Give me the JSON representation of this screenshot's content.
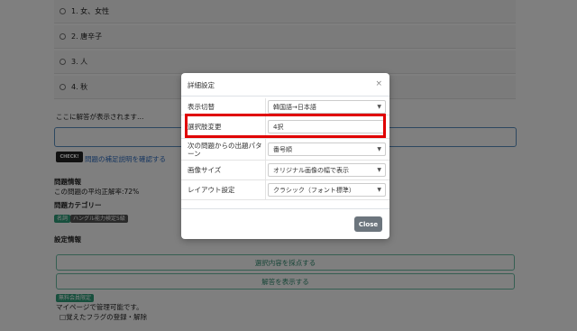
{
  "options": [
    {
      "label": "1. 女、女性"
    },
    {
      "label": "2. 唐辛子"
    },
    {
      "label": "3. 人"
    },
    {
      "label": "4. 秋"
    }
  ],
  "answer_placeholder": "ここに解答が表示されます…",
  "check_badge": "CHECK!",
  "supplement_link": "問題の補足説明を確認する",
  "problem_info": {
    "heading": "問題情報",
    "accuracy": "この問題の平均正解率:72%"
  },
  "category": {
    "heading": "問題カテゴリー",
    "tags": [
      "名詞",
      "ハングル能力検定5級"
    ]
  },
  "settings": {
    "heading": "設定情報",
    "grade_button": "選択内容を採点する",
    "show_answer_button": "解答を表示する",
    "member_badge": "無料会員限定",
    "mypage_note": "マイページで管理可能です。",
    "flag_label": "□覚えたフラグの登録・解除"
  },
  "modal": {
    "title": "詳細設定",
    "close_x": "×",
    "rows": [
      {
        "label": "表示切替",
        "value": "韓国語→日本語"
      },
      {
        "label": "選択肢変更",
        "value": "4択"
      },
      {
        "label": "次の問題からの出題パターン",
        "value": "番号順"
      },
      {
        "label": "画像サイズ",
        "value": "オリジナル画像の幅で表示"
      },
      {
        "label": "レイアウト設定",
        "value": "クラシック（フォント標準）"
      }
    ],
    "close_button": "Close"
  },
  "colors": {
    "highlight": "#e00000",
    "close_button": "#6c757d",
    "tag_green": "#2f9e7a",
    "tag_gray": "#555555",
    "link_blue": "#2d6cc0"
  }
}
